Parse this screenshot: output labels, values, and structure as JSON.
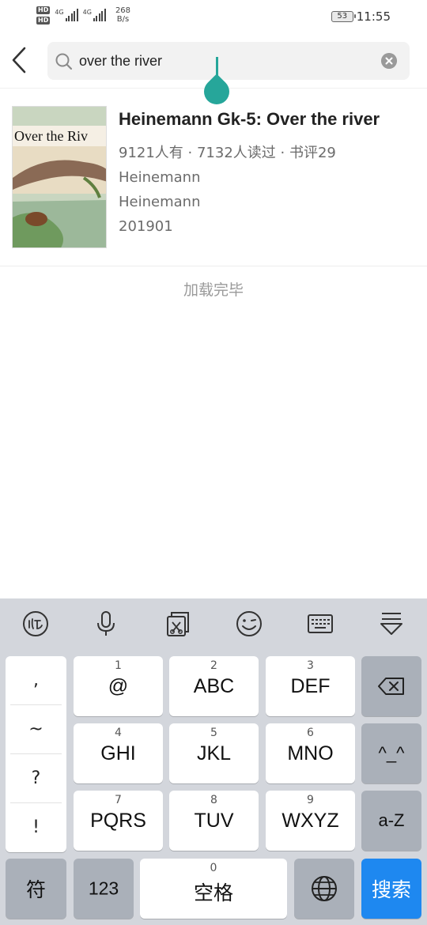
{
  "status_bar": {
    "hd_badge_1": "HD",
    "hd_badge_2": "HD",
    "sim1_type": "4G",
    "sim2_type": "4G",
    "net_speed_value": "268",
    "net_speed_unit": "B/s",
    "battery": "53",
    "time": "11:55",
    "icons": [
      "signal-icon",
      "battery-icon"
    ]
  },
  "search": {
    "query": "over the river",
    "icons": [
      "back-arrow-icon",
      "search-icon",
      "clear-icon"
    ],
    "accent": "#26a69a"
  },
  "result": {
    "cover_text": "Over the Riv",
    "title": "Heinemann Gk-5: Over the river",
    "stats": "9121人有 · 7132人读过 · 书评29",
    "author": "Heinemann",
    "publisher": "Heinemann",
    "date": "201901"
  },
  "load_status": "加载完毕",
  "keyboard": {
    "toolbar_icons": [
      "ifly-logo-icon",
      "microphone-icon",
      "clipboard-icon",
      "emoji-icon",
      "keyboard-icon",
      "hide-keyboard-icon"
    ],
    "punctuation": [
      ",",
      "~",
      "?",
      "!"
    ],
    "keys": {
      "k1": {
        "num": "1",
        "label": "@"
      },
      "k2": {
        "num": "2",
        "label": "ABC"
      },
      "k3": {
        "num": "3",
        "label": "DEF"
      },
      "k4": {
        "num": "4",
        "label": "GHI"
      },
      "k5": {
        "num": "5",
        "label": "JKL"
      },
      "k6": {
        "num": "6",
        "label": "MNO"
      },
      "k7": {
        "num": "7",
        "label": "PQRS"
      },
      "k8": {
        "num": "8",
        "label": "TUV"
      },
      "k9": {
        "num": "9",
        "label": "WXYZ"
      },
      "k0": {
        "num": "0",
        "label": "空格"
      }
    },
    "face_key": "^_^",
    "case_key": "a-Z",
    "symbol_key": "符",
    "number_key": "123",
    "search_key": "搜索",
    "search_key_color": "#1e88f0"
  }
}
